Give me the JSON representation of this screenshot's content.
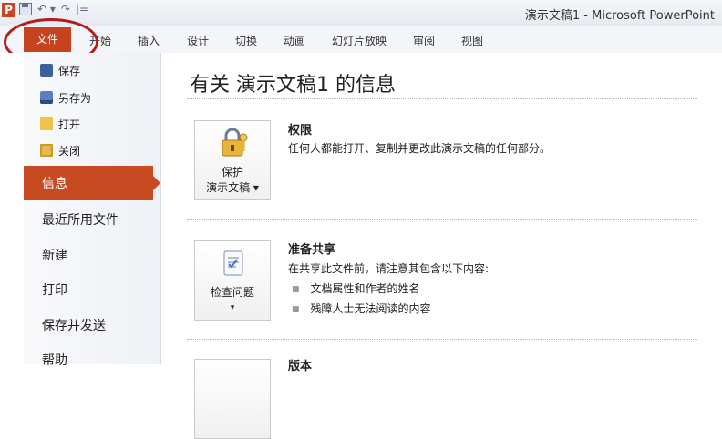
{
  "window": {
    "app_letter": "P",
    "title": "演示文稿1 - Microsoft PowerPoint",
    "qat_undo": "↶ ▾",
    "qat_redo": "↷",
    "qat_sep": "|="
  },
  "ribbon": {
    "file_tab": "文件",
    "tabs": [
      "开始",
      "插入",
      "设计",
      "切换",
      "动画",
      "幻灯片放映",
      "审阅",
      "视图"
    ]
  },
  "nav": {
    "small_items": [
      "保存",
      "另存为",
      "打开",
      "关闭"
    ],
    "active_item": "信息",
    "items": [
      "最近所用文件",
      "新建",
      "打印",
      "保存并发送",
      "帮助"
    ]
  },
  "info": {
    "title": "有关 演示文稿1 的信息",
    "permissions": {
      "button_line1": "保护",
      "button_line2": "演示文稿 ▾",
      "heading": "权限",
      "description": "任何人都能打开、复制并更改此演示文稿的任何部分。"
    },
    "prepare": {
      "button_label": "检查问题",
      "button_arrow": "▾",
      "heading": "准备共享",
      "description": "在共享此文件前，请注意其包含以下内容:",
      "bullets": [
        "文档属性和作者的姓名",
        "残障人士无法阅读的内容"
      ]
    },
    "versions": {
      "heading": "版本"
    }
  },
  "colors": {
    "accent": "#c74a23",
    "annotation": "#b41c1c"
  }
}
